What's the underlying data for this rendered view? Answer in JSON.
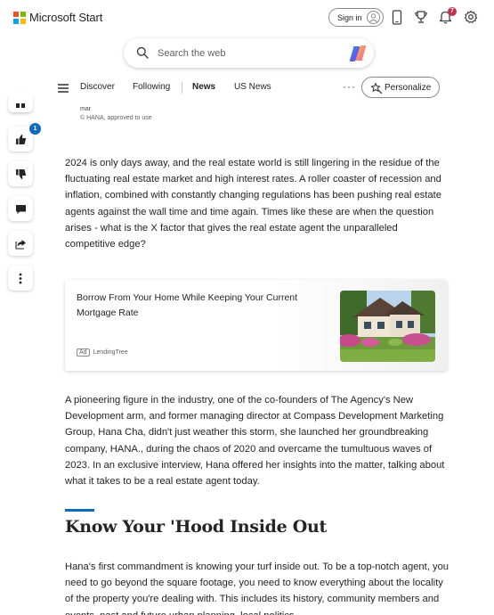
{
  "header": {
    "brand": "Microsoft Start",
    "brand_colors": [
      "#f25022",
      "#7fba00",
      "#00a4ef",
      "#ffb900"
    ],
    "signin_label": "Sign in",
    "notification_count": "7"
  },
  "search": {
    "placeholder": "Search the web"
  },
  "nav": {
    "items": [
      {
        "label": "Discover"
      },
      {
        "label": "Following"
      },
      {
        "label": "News"
      },
      {
        "label": "US News"
      }
    ],
    "personalize_label": "Personalize"
  },
  "rail": {
    "like_count": "1"
  },
  "article": {
    "caption_name": "mar",
    "caption_credit": "© HANA, approved to use",
    "paragraph1": "2024 is only days away, and the real estate world is still lingering in the residue of the fluctuating real estate market and high interest rates. A roller coaster of recession and inflation, combined with constantly changing regulations has been pushing real estate agents against the wall time and time again. Times like these are when the question arises - what is the X factor that gives the real estate agent the unparalleled competitive edge?",
    "ad": {
      "title": "Borrow From Your Home While Keeping Your Current Mortgage Rate",
      "tag": "Ad",
      "sponsor": "LendingTree"
    },
    "paragraph2": "A pioneering figure in the industry, one of the co-founders of The Agency's New Development arm, and former managing director at Compass Development Marketing Group, Hana Cha, didn't just weather this storm, she launched her groundbreaking company, HANA., during the chaos of 2020 and overcame the tumultuous waves of 2023. In an exclusive interview, Hana offered her insights into the matter, talking about what it takes to be a real estate agent today.",
    "heading": "Know Your 'Hood Inside Out",
    "paragraph3": "Hana's first commandment is knowing your turf inside out. To be a top-notch agent, you need to go beyond the square footage, you need to know everything about the locality of the property you're dealing with. This includes its history, community members and events, past and future urban planning, local politics –"
  },
  "colors": {
    "accent": "#0f6cbd",
    "badge": "#c4314b"
  }
}
